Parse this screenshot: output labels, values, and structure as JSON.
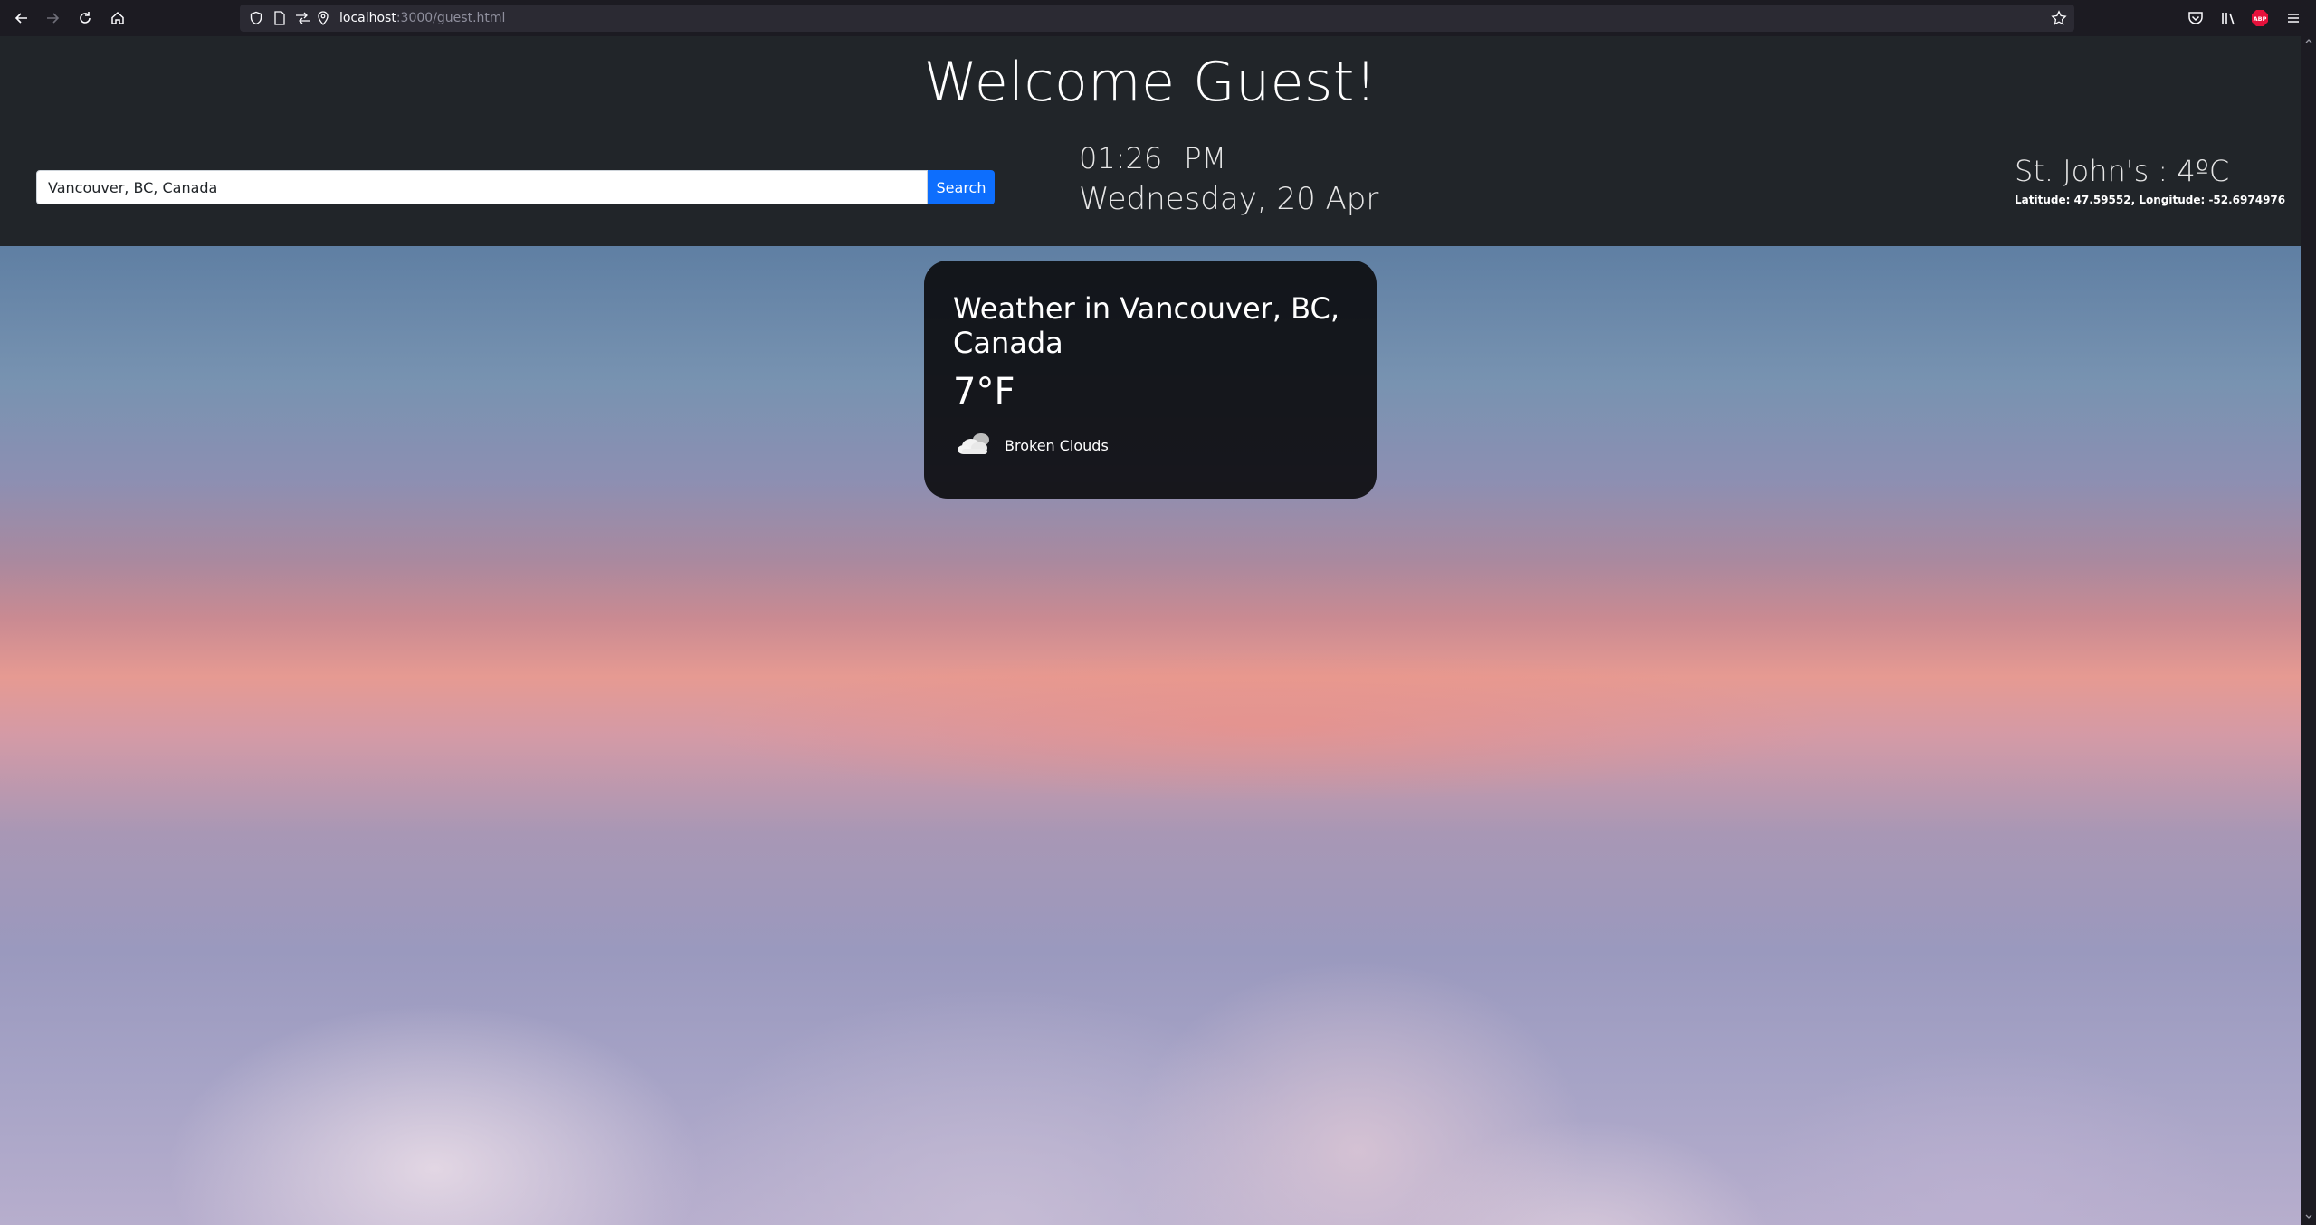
{
  "browser": {
    "url_host": "localhost",
    "url_rest": ":3000/guest.html",
    "icons": [
      "back-icon",
      "forward-icon",
      "reload-icon",
      "home-icon",
      "shield-icon",
      "page-icon",
      "permissions-icon",
      "location-icon",
      "star-icon",
      "pocket-icon",
      "library-icon",
      "abp-icon",
      "menu-icon"
    ],
    "abp_label": "ABP"
  },
  "header": {
    "title": "Welcome Guest!",
    "search": {
      "value": "Vancouver, BC, Canada",
      "button_label": "Search"
    },
    "clock": {
      "time": "01:26",
      "ampm": "PM",
      "date": "Wednesday, 20 Apr"
    },
    "location": {
      "temp_text": "St. John's : 4ºC",
      "coords_text": "Latitude: 47.59552, Longitude: -52.6974976"
    }
  },
  "weather_card": {
    "title": "Weather in Vancouver, BC, Canada",
    "temperature": "7°F",
    "icon": "broken-clouds-icon",
    "description": "Broken Clouds"
  },
  "colors": {
    "header_bg": "#212529",
    "search_button": "#0d6efd",
    "card_bg": "#0a0a0c",
    "abp_badge": "#e5113b"
  }
}
